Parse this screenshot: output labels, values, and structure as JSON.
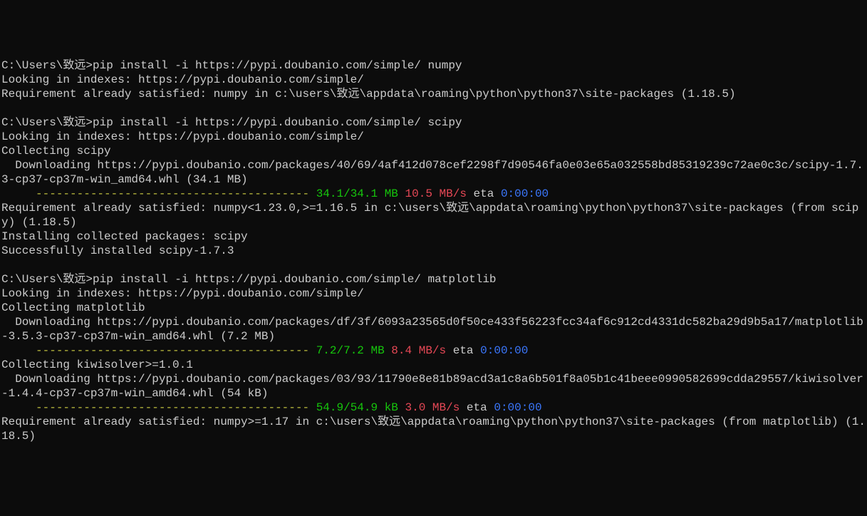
{
  "lines": {
    "l1_prompt": "C:\\Users\\致远>",
    "l1_cmd": "pip install -i https://pypi.doubanio.com/simple/ numpy",
    "l2": "Looking in indexes: https://pypi.doubanio.com/simple/",
    "l3": "Requirement already satisfied: numpy in c:\\users\\致远\\appdata\\roaming\\python\\python37\\site-packages (1.18.5)",
    "l4": "",
    "l5_prompt": "C:\\Users\\致远>",
    "l5_cmd": "pip install -i https://pypi.doubanio.com/simple/ scipy",
    "l6": "Looking in indexes: https://pypi.doubanio.com/simple/",
    "l7": "Collecting scipy",
    "l8": "  Downloading https://pypi.doubanio.com/packages/40/69/4af412d078cef2298f7d90546fa0e03e65a032558bd85319239c72ae0c3c/scipy-1.7.3-cp37-cp37m-win_amd64.whl (34.1 MB)",
    "l9_pad": "     ",
    "l9_bar": "---------------------------------------- ",
    "l9_size": "34.1/34.1 MB",
    "l9_speed": " 10.5 MB/s",
    "l9_eta_label": " eta ",
    "l9_eta": "0:00:00",
    "l10": "Requirement already satisfied: numpy<1.23.0,>=1.16.5 in c:\\users\\致远\\appdata\\roaming\\python\\python37\\site-packages (from scipy) (1.18.5)",
    "l11": "Installing collected packages: scipy",
    "l12": "Successfully installed scipy-1.7.3",
    "l13": "",
    "l14_prompt": "C:\\Users\\致远>",
    "l14_cmd": "pip install -i https://pypi.doubanio.com/simple/ matplotlib",
    "l15": "Looking in indexes: https://pypi.doubanio.com/simple/",
    "l16": "Collecting matplotlib",
    "l17": "  Downloading https://pypi.doubanio.com/packages/df/3f/6093a23565d0f50ce433f56223fcc34af6c912cd4331dc582ba29d9b5a17/matplotlib-3.5.3-cp37-cp37m-win_amd64.whl (7.2 MB)",
    "l18_pad": "     ",
    "l18_bar": "---------------------------------------- ",
    "l18_size": "7.2/7.2 MB",
    "l18_speed": " 8.4 MB/s",
    "l18_eta_label": " eta ",
    "l18_eta": "0:00:00",
    "l19": "Collecting kiwisolver>=1.0.1",
    "l20": "  Downloading https://pypi.doubanio.com/packages/03/93/11790e8e81b89acd3a1c8a6b501f8a05b1c41beee0990582699cdda29557/kiwisolver-1.4.4-cp37-cp37m-win_amd64.whl (54 kB)",
    "l21_pad": "     ",
    "l21_bar": "---------------------------------------- ",
    "l21_size": "54.9/54.9 kB",
    "l21_speed": " 3.0 MB/s",
    "l21_eta_label": " eta ",
    "l21_eta": "0:00:00",
    "l22": "Requirement already satisfied: numpy>=1.17 in c:\\users\\致远\\appdata\\roaming\\python\\python37\\site-packages (from matplotlib) (1.18.5)"
  }
}
